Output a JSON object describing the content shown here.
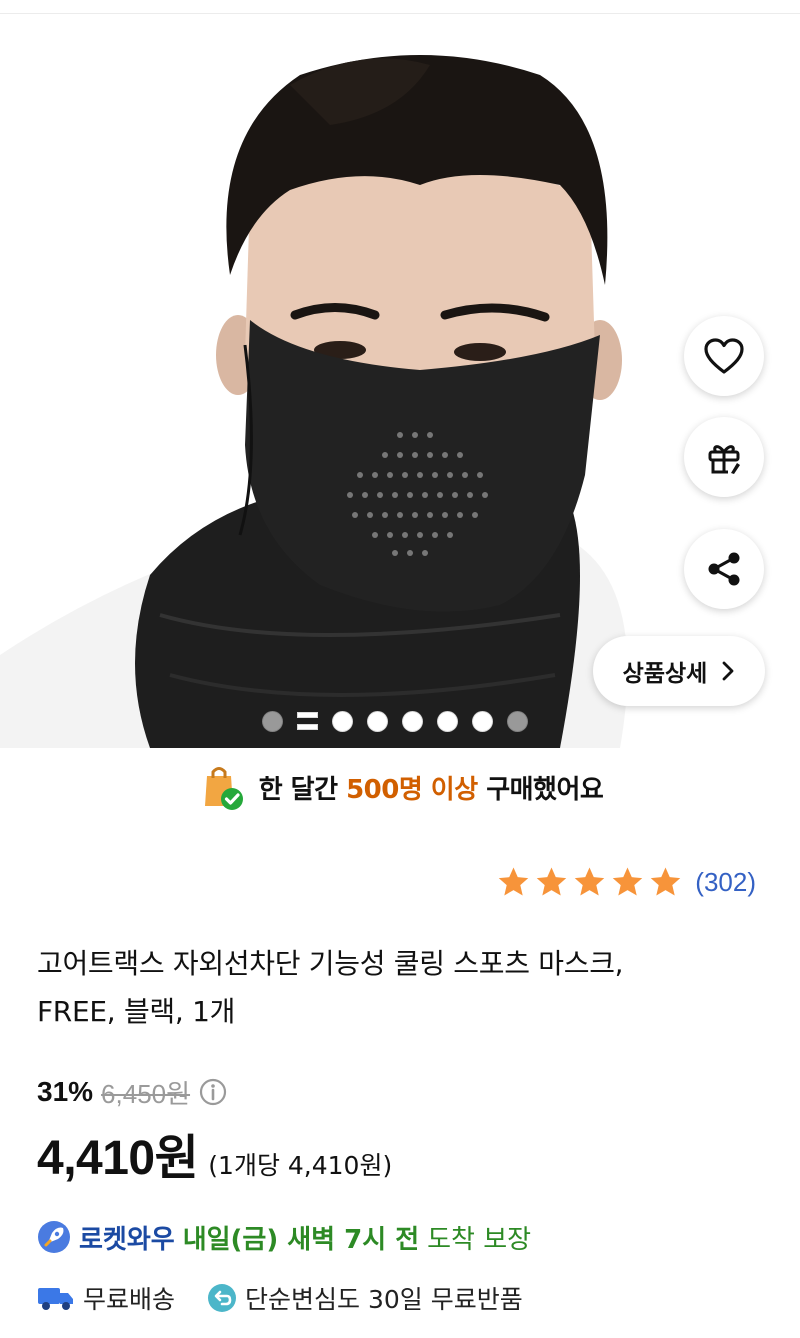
{
  "colors": {
    "accent_orange": "#d15f00",
    "star": "#f7943a",
    "review_count": "#3461c4",
    "rocket_blue": "#1b4aa3",
    "delivery_green": "#2d8a25"
  },
  "gallery": {
    "image_alt": "man wearing black sports cooling mask",
    "slide_count": 8,
    "active_slide": 2
  },
  "actions": {
    "wishlist_icon": "heart-icon",
    "gift_icon": "gift-icon",
    "share_icon": "share-icon",
    "detail_label": "상품상세"
  },
  "purchase_notice": {
    "prefix": "한 달간 ",
    "highlight": "500명 이상",
    "suffix": " 구매했어요"
  },
  "rating": {
    "stars": 5,
    "count_text": "(302)"
  },
  "product": {
    "title_line1": "고어트랙스 자외선차단 기능성 쿨링 스포츠 마스크,",
    "title_line2": "FREE, 블랙, 1개"
  },
  "price": {
    "discount": "31%",
    "original": "6,450원",
    "current": "4,410원",
    "unit_price": "(1개당 4,410원)"
  },
  "delivery": {
    "rocket_label": "로켓와우",
    "arrival": "내일(금) 새벽 7시 전",
    "guarantee": "도착 보장",
    "free_shipping": "무료배송",
    "free_return": "단순변심도 30일 무료반품"
  }
}
